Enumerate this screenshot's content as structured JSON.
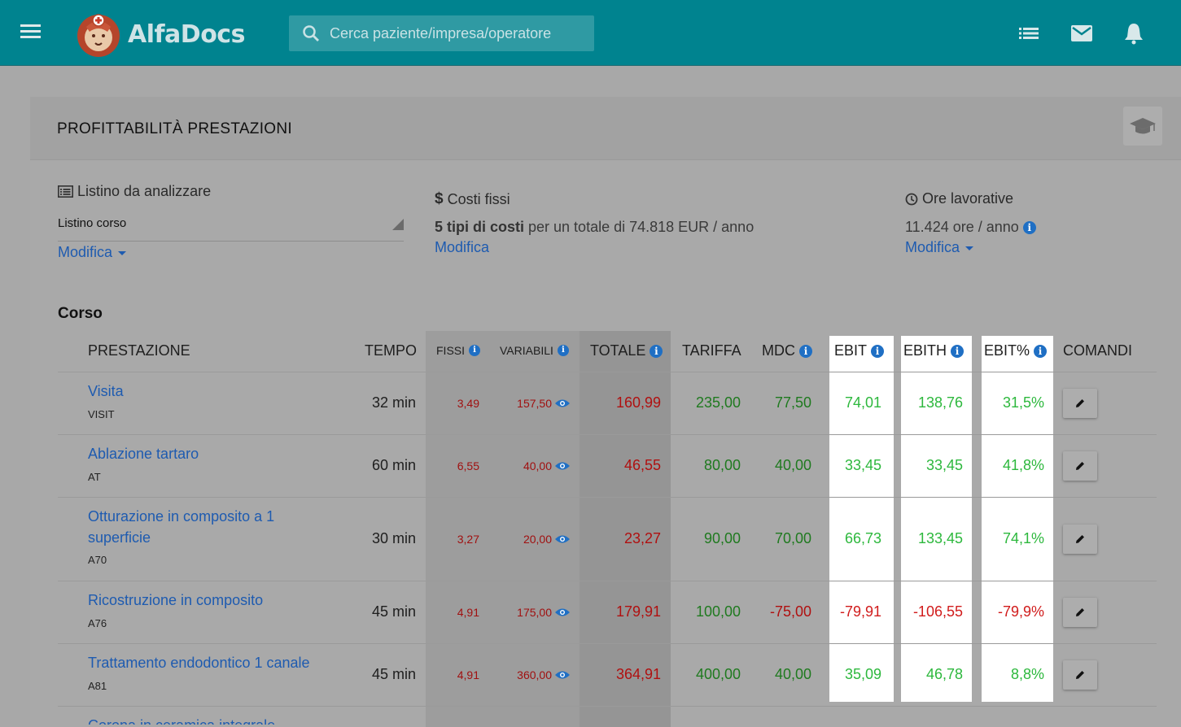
{
  "header": {
    "logo_text": "AlfaDocs",
    "search_placeholder": "Cerca paziente/impresa/operatore",
    "icons": [
      "menu-icon",
      "list-icon",
      "mail-icon",
      "bell-icon"
    ]
  },
  "page": {
    "title": "PROFITTABILITÀ PRESTAZIONI",
    "help_icon": "graduation-cap-icon"
  },
  "filters": {
    "listino": {
      "label": "Listino da analizzare",
      "value": "Listino corso",
      "action": "Modifica"
    },
    "costi_fissi": {
      "label": "Costi fissi",
      "bold": "5 tipi di costi",
      "text": " per un totale di 74.818 EUR / anno",
      "action": "Modifica"
    },
    "ore": {
      "label": "Ore lavorative",
      "text": "11.424 ore / anno",
      "action": "Modifica"
    }
  },
  "section_title": "Corso",
  "table": {
    "headers": {
      "prestazione": "PRESTAZIONE",
      "tempo": "TEMPO",
      "fissi": "FISSI",
      "variabili": "VARIABILI",
      "totale": "TOTALE",
      "tariffa": "TARIFFA",
      "mdc": "MDC",
      "ebit": "EBIT",
      "ebith": "EBITH",
      "ebit_pct": "EBIT%",
      "comandi": "COMANDI"
    },
    "rows": [
      {
        "name": "Visita",
        "code": "VISIT",
        "tempo": "32 min",
        "fissi": "3,49",
        "variabili": "157,50",
        "totale": "160,99",
        "tariffa": "235,00",
        "mdc": "77,50",
        "ebit": "74,01",
        "ebith": "138,76",
        "ebit_pct": "31,5%"
      },
      {
        "name": "Ablazione tartaro",
        "code": "AT",
        "tempo": "60 min",
        "fissi": "6,55",
        "variabili": "40,00",
        "totale": "46,55",
        "tariffa": "80,00",
        "mdc": "40,00",
        "ebit": "33,45",
        "ebith": "33,45",
        "ebit_pct": "41,8%"
      },
      {
        "name": "Otturazione in composito a 1 superficie",
        "code": "A70",
        "tempo": "30 min",
        "fissi": "3,27",
        "variabili": "20,00",
        "totale": "23,27",
        "tariffa": "90,00",
        "mdc": "70,00",
        "ebit": "66,73",
        "ebith": "133,45",
        "ebit_pct": "74,1%"
      },
      {
        "name": "Ricostruzione in composito",
        "code": "A76",
        "tempo": "45 min",
        "fissi": "4,91",
        "variabili": "175,00",
        "totale": "179,91",
        "tariffa": "100,00",
        "mdc": "-75,00",
        "ebit": "-79,91",
        "ebith": "-106,55",
        "ebit_pct": "-79,9%"
      },
      {
        "name": "Trattamento endodontico 1 canale",
        "code": "A81",
        "tempo": "45 min",
        "fissi": "4,91",
        "variabili": "360,00",
        "totale": "364,91",
        "tariffa": "400,00",
        "mdc": "40,00",
        "ebit": "35,09",
        "ebith": "46,78",
        "ebit_pct": "8,8%"
      },
      {
        "name": "Corona in ceramica integrale",
        "code": "",
        "tempo": "",
        "fissi": "",
        "variabili": "",
        "totale": "",
        "tariffa": "",
        "mdc": "",
        "ebit": "",
        "ebith": "",
        "ebit_pct": ""
      }
    ]
  }
}
